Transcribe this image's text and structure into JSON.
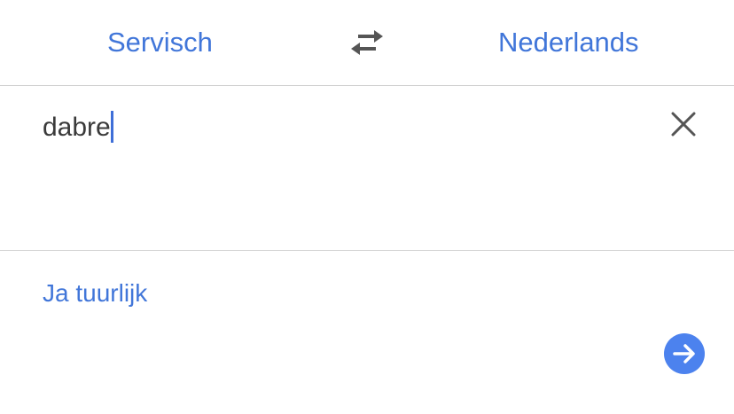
{
  "header": {
    "source_language": "Servisch",
    "target_language": "Nederlands",
    "swap_icon": "swap-arrows-icon"
  },
  "input": {
    "text": "dabre",
    "clear_icon": "close-icon"
  },
  "result": {
    "suggestion": "Ja tuurlijk",
    "go_icon": "arrow-right-icon"
  },
  "colors": {
    "accent": "#4176d9",
    "go_button": "#4c82ee",
    "text": "#3a3a3a",
    "icon": "#555555",
    "divider": "#cfcfcf"
  }
}
